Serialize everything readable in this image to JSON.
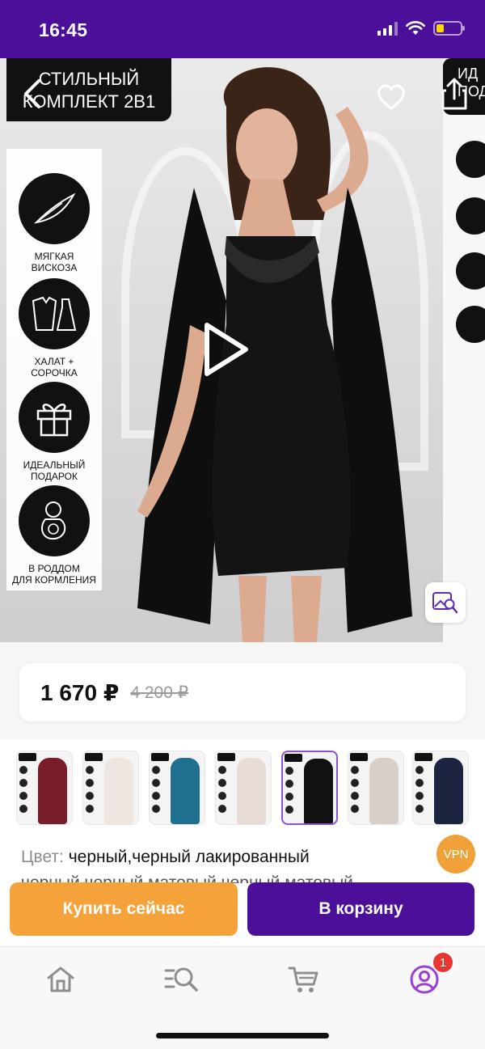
{
  "status_bar": {
    "time": "16:45"
  },
  "hero": {
    "promo_title_line1": "СТИЛЬНЫЙ",
    "promo_title_line2": "КОМПЛЕКТ 2в1",
    "next_image_text": "ИД\nПОД",
    "badges": [
      {
        "label": "МЯГКАЯ\nВИСКОЗА",
        "icon": "feather-icon"
      },
      {
        "label": "ХАЛАТ +\nСОРОЧКА",
        "icon": "robe-icon"
      },
      {
        "label": "ИДЕАЛЬНЫЙ\nПОДАРОК",
        "icon": "gift-icon"
      },
      {
        "label": "В РОДДОМ\nДЛЯ КОРМЛЕНИЯ",
        "icon": "baby-icon"
      }
    ]
  },
  "price": {
    "current": "1 670 ₽",
    "old": "4 200 ₽"
  },
  "variants": [
    {
      "color": "#7a1d2b",
      "selected": false
    },
    {
      "color": "#eee5de",
      "selected": false
    },
    {
      "color": "#1f6f8f",
      "selected": false
    },
    {
      "color": "#e8ddd6",
      "selected": false
    },
    {
      "color": "#111111",
      "selected": true
    },
    {
      "color": "#d9cfc9",
      "selected": false
    },
    {
      "color": "#1c2440",
      "selected": false
    }
  ],
  "color_info": {
    "label": "Цвет:",
    "value": "черный,черный лакированный",
    "value_line2": "черный,черный матовый,черный матовый"
  },
  "vpn_badge": "VPN",
  "actions": {
    "buy_now": "Купить сейчас",
    "add_to_cart": "В корзину"
  },
  "tab_bar": {
    "profile_badge": "1"
  },
  "colors": {
    "brand_purple": "#4b0f9a",
    "accent_orange": "#f5a23a",
    "badge_red": "#e8352f"
  }
}
